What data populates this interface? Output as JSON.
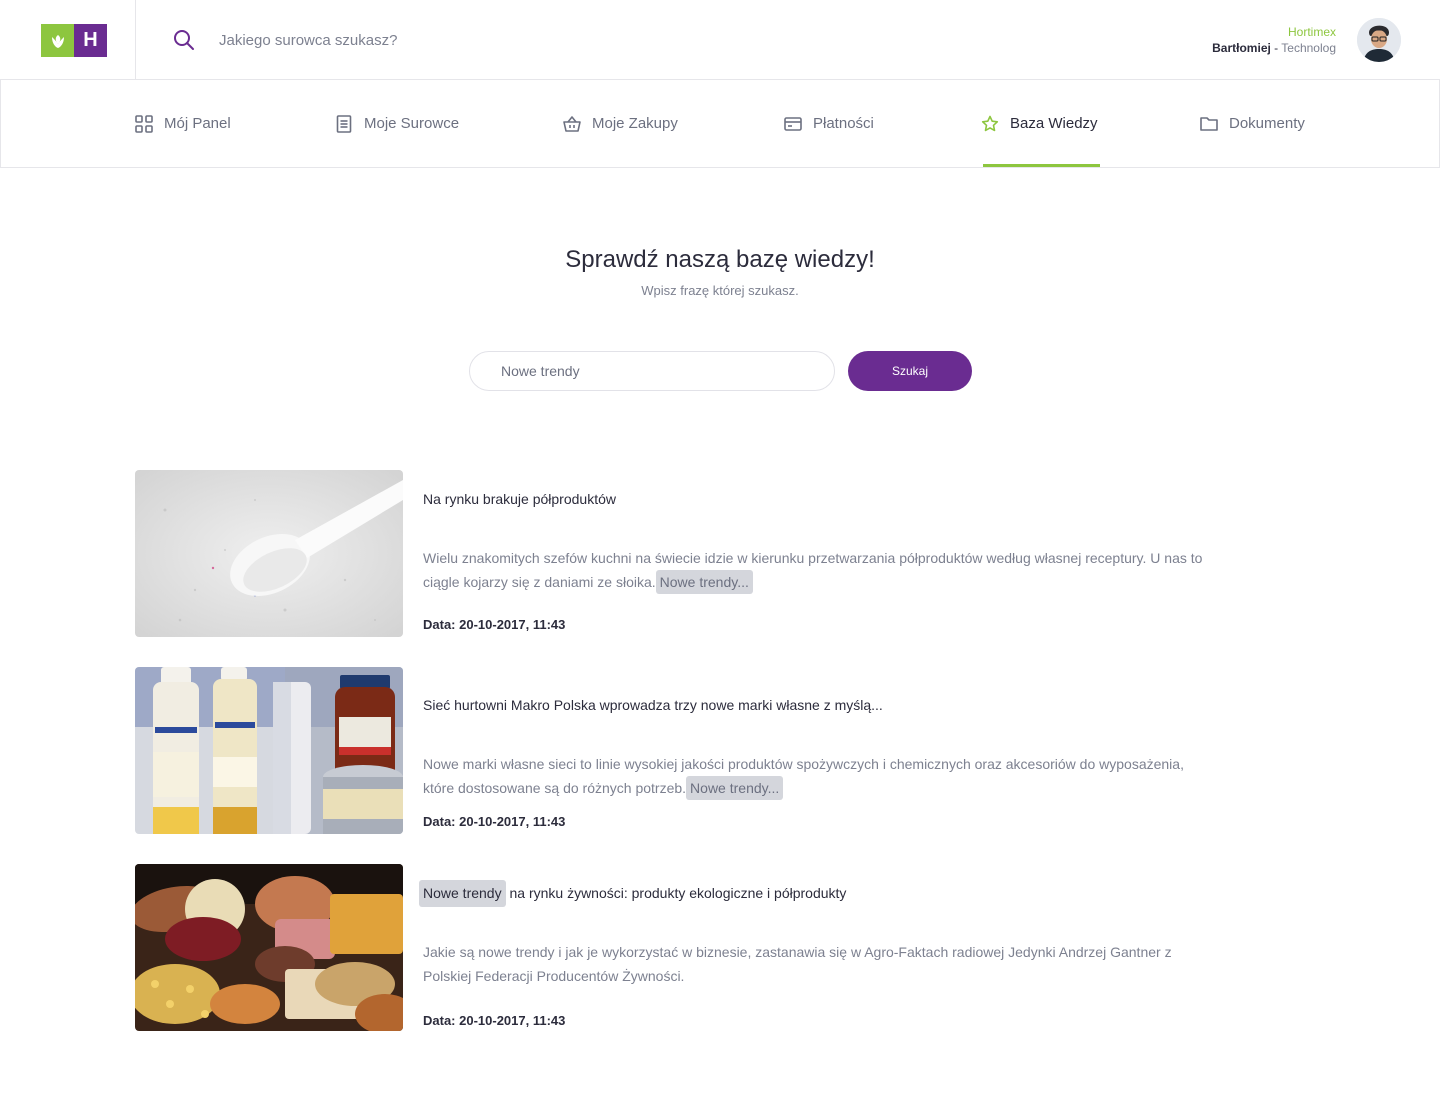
{
  "header": {
    "search_placeholder": "Jakiego surowca szukasz?",
    "logo_letter": "H",
    "user": {
      "company": "Hortimex",
      "name": "Bartłomiej",
      "separator": " - ",
      "role": "Technolog"
    }
  },
  "nav": {
    "items": [
      {
        "label": "Mój Panel",
        "icon": "grid-icon"
      },
      {
        "label": "Moje Surowce",
        "icon": "document-icon"
      },
      {
        "label": "Moje Zakupy",
        "icon": "basket-icon"
      },
      {
        "label": "Płatności",
        "icon": "card-icon"
      },
      {
        "label": "Baza Wiedzy",
        "icon": "star-icon",
        "active": true
      },
      {
        "label": "Dokumenty",
        "icon": "folder-icon"
      }
    ]
  },
  "hero": {
    "title": "Sprawdź naszą bazę wiedzy!",
    "subtitle": "Wpisz frazę której szukasz.",
    "search_value": "Nowe trendy",
    "button_label": "Szukaj"
  },
  "articles": [
    {
      "title": "Na rynku brakuje półproduktów",
      "body": "Wielu znakomitych szefów kuchni na świecie idzie w kierunku przetwarzania półproduktów według własnej receptury. U nas to ciągle kojarzy się z daniami ze słoika.",
      "more": "Nowe trendy...",
      "date": "Data: 20-10-2017, 11:43"
    },
    {
      "title": "Sieć hurtowni Makro Polska wprowadza trzy nowe marki własne z myślą...",
      "body": "Nowe marki własne sieci to linie wysokiej jakości produktów spożywczych i chemicznych oraz akcesoriów do wyposażenia, które dostosowane są do różnych potrzeb.",
      "more": "Nowe trendy...",
      "date": "Data: 20-10-2017, 11:43"
    },
    {
      "title_highlight": "Nowe trendy",
      "title": " na rynku żywności: produkty ekologiczne i półprodukty",
      "body": "Jakie są nowe trendy i jak je wykorzystać w biznesie, zastanawia się w Agro-Faktach radiowej Jedynki Andrzej Gantner z Polskiej Federacji Producentów Żywności.",
      "date": "Data: 20-10-2017, 11:43"
    }
  ],
  "colors": {
    "brand_green": "#8dc63f",
    "brand_purple": "#6a2c91",
    "highlight": "#d4d6dc"
  }
}
